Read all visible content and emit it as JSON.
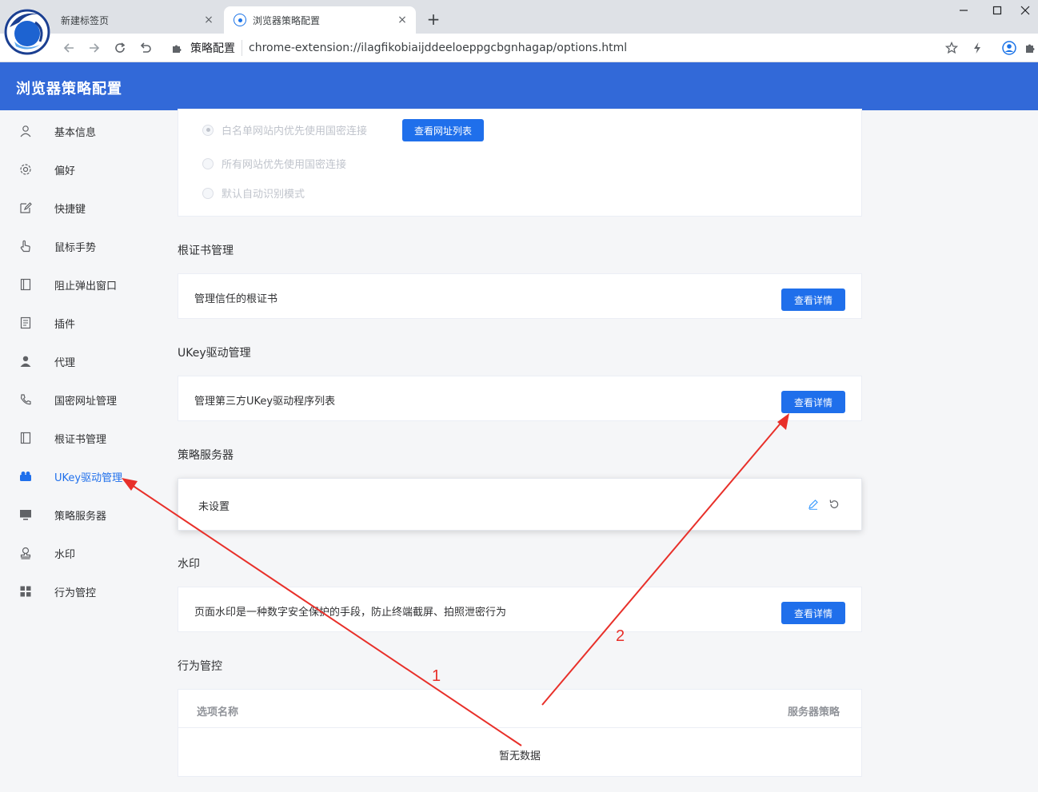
{
  "browser": {
    "tabs": [
      {
        "title": "新建标签页"
      },
      {
        "title": "浏览器策略配置"
      }
    ],
    "tab_close_glyph": "×",
    "new_tab_glyph": "+",
    "omnibox": {
      "label": "策略配置",
      "url": "chrome-extension://ilagfikobiaijddeeloeppgcbgnhagap/options.html"
    }
  },
  "app": {
    "title": "浏览器策略配置",
    "accent_color": "#3269d8",
    "button_color": "#1f6feb"
  },
  "sidebar": {
    "items": [
      {
        "label": "基本信息",
        "icon": "user-icon"
      },
      {
        "label": "偏好",
        "icon": "gear-icon"
      },
      {
        "label": "快捷键",
        "icon": "edit-icon"
      },
      {
        "label": "鼠标手势",
        "icon": "hand-pointer-icon"
      },
      {
        "label": "阻止弹出窗口",
        "icon": "window-icon"
      },
      {
        "label": "插件",
        "icon": "document-icon"
      },
      {
        "label": "代理",
        "icon": "person-filled-icon"
      },
      {
        "label": "国密网址管理",
        "icon": "phone-icon"
      },
      {
        "label": "根证书管理",
        "icon": "book-icon"
      },
      {
        "label": "UKey驱动管理",
        "icon": "ukey-icon",
        "active": true
      },
      {
        "label": "策略服务器",
        "icon": "monitor-icon"
      },
      {
        "label": "水印",
        "icon": "stamp-icon"
      },
      {
        "label": "行为管控",
        "icon": "grid-icon"
      }
    ]
  },
  "gm_mode": {
    "options": [
      {
        "label": "白名单网站内优先使用国密连接",
        "checked": true
      },
      {
        "label": "所有网站优先使用国密连接",
        "checked": false
      },
      {
        "label": "默认自动识别模式",
        "checked": false
      }
    ],
    "view_list_button": "查看网址列表"
  },
  "sections": {
    "root_cert": {
      "title": "根证书管理",
      "description": "管理信任的根证书",
      "button": "查看详情"
    },
    "ukey": {
      "title": "UKey驱动管理",
      "description": "管理第三方UKey驱动程序列表",
      "button": "查看详情"
    },
    "policy_server": {
      "title": "策略服务器",
      "value": "未设置"
    },
    "watermark": {
      "title": "水印",
      "description": "页面水印是一种数字安全保护的手段，防止终端截屏、拍照泄密行为",
      "button": "查看详情"
    },
    "behavior": {
      "title": "行为管控",
      "columns": [
        "选项名称",
        "服务器策略"
      ],
      "empty_text": "暂无数据"
    }
  },
  "annotations": {
    "color": "#e8302a",
    "labels": [
      "1",
      "2"
    ]
  }
}
